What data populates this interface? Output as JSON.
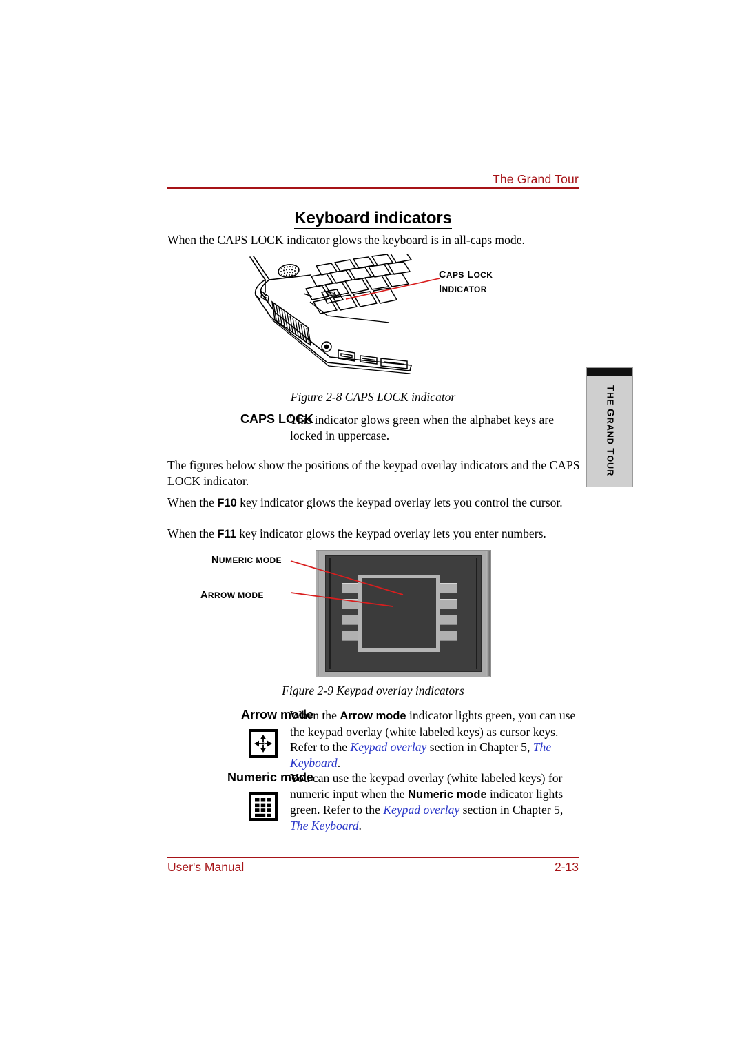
{
  "header": {
    "title": "The Grand Tour"
  },
  "section": {
    "heading": "Keyboard indicators"
  },
  "paragraphs": {
    "intro": "When the CAPS LOCK indicator glows the keyboard is in all-caps mode.",
    "figures_note": "The figures below show the positions of the keypad overlay indicators and the CAPS LOCK indicator.",
    "f10_before": "When the ",
    "f10_key": "F10",
    "f10_after": " key indicator glows the keypad overlay lets you control the cursor.",
    "f11_before": "When the ",
    "f11_key": "F11",
    "f11_after": " key indicator glows the keypad overlay lets you enter numbers."
  },
  "figure1": {
    "caption": "Figure 2-8 CAPS LOCK indicator",
    "callout_line1_cap": "C",
    "callout_line1_rest": "APS",
    "callout_line1_word2_cap": "L",
    "callout_line1_word2_rest": "OCK",
    "callout_line2_cap": "I",
    "callout_line2_rest": "NDICATOR",
    "alt": "Line drawing of laptop front-left corner showing keyboard and CAPS LOCK indicator"
  },
  "figure2": {
    "caption": "Figure 2-9 Keypad overlay indicators",
    "callout_numeric_cap": "N",
    "callout_numeric_rest": "UMERIC MODE",
    "callout_arrow_cap": "A",
    "callout_arrow_rest": "RROW MODE",
    "alt": "Photo of keypad overlay indicator panel"
  },
  "definitions": {
    "caps_lock": {
      "term": "CAPS LOCK",
      "body": "This indicator glows green when the alphabet keys are locked in uppercase."
    },
    "arrow_mode": {
      "term": "Arrow mode",
      "icon": "arrow-mode-icon",
      "text_1": "When the ",
      "bold_1": "Arrow mode",
      "text_2": " indicator lights green, you can use the keypad overlay (white labeled keys) as cursor keys. Refer to the ",
      "link_1": "Keypad overlay",
      "text_3": " section in Chapter 5, ",
      "link_2": "The Keyboard",
      "text_4": "."
    },
    "numeric_mode": {
      "term": "Numeric mode",
      "icon": "numeric-mode-icon",
      "text_1": "You can use the keypad overlay (white labeled keys) for numeric input when the ",
      "bold_1": "Numeric mode",
      "text_2": " indicator lights green. Refer to the ",
      "link_1": "Keypad overlay",
      "text_3": " section in Chapter 5, ",
      "link_2": "The Keyboard",
      "text_4": "."
    }
  },
  "side_tab": {
    "cap1": "T",
    "rest1": "HE ",
    "cap2": "G",
    "rest2": "RAND ",
    "cap3": "T",
    "rest3": "OUR"
  },
  "footer": {
    "left": "User's Manual",
    "right": "2-13"
  },
  "colors": {
    "accent_red": "#A61317",
    "link_blue": "#2936C8",
    "tab_gray": "#CFCFCF"
  }
}
